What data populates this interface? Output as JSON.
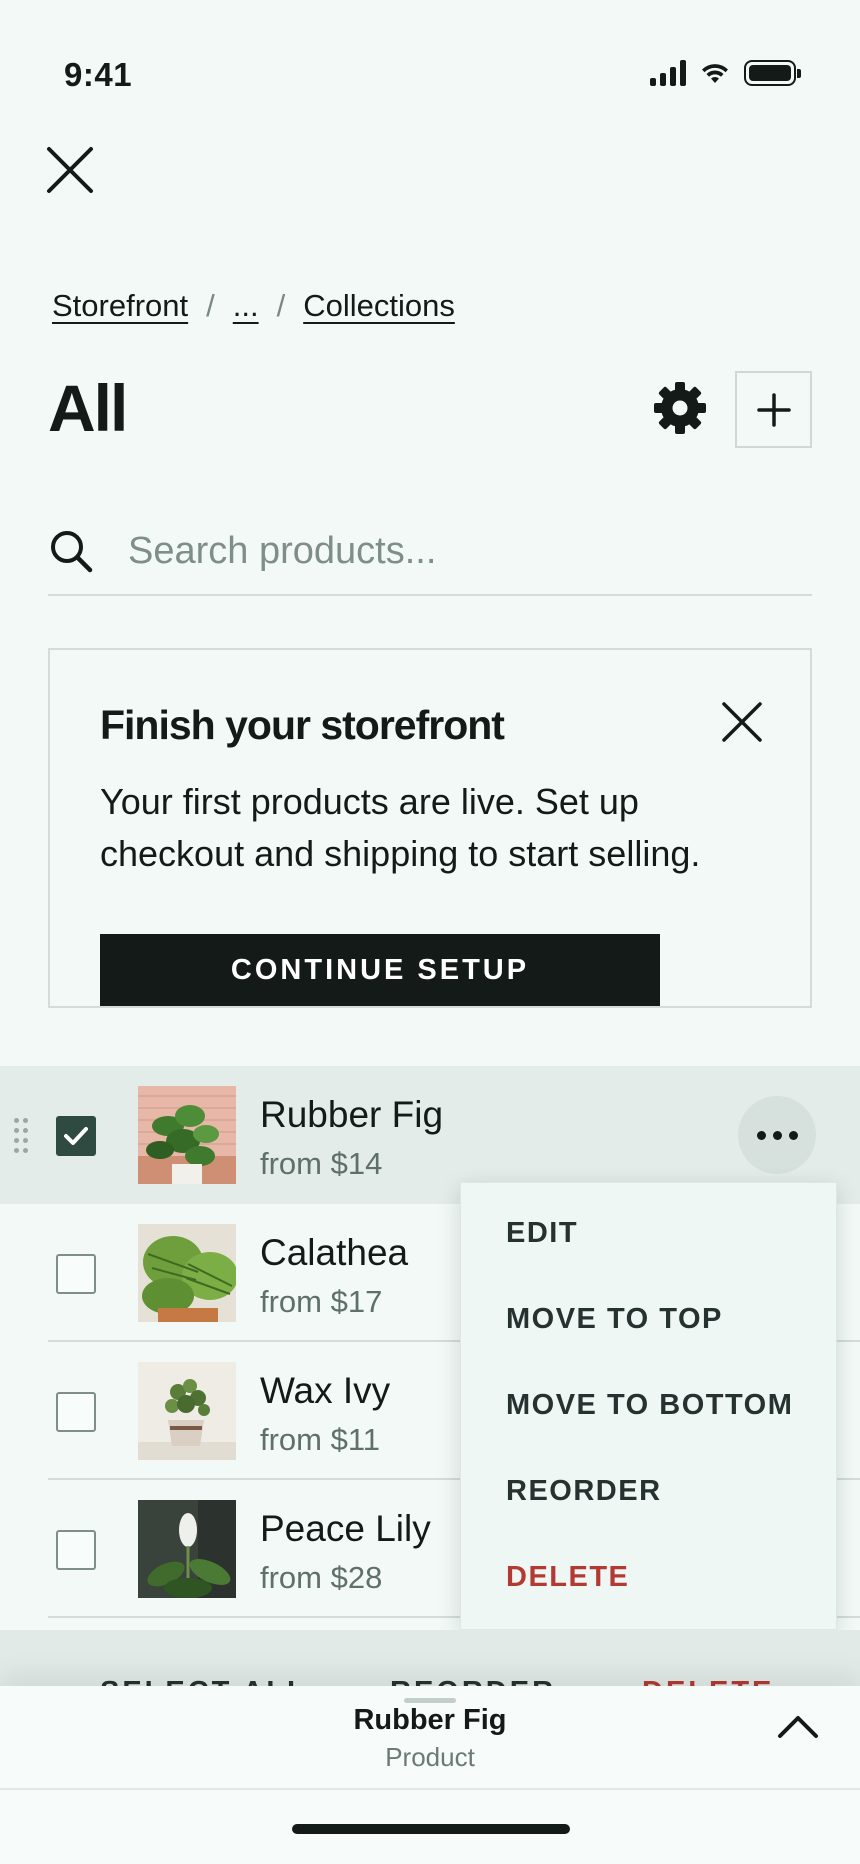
{
  "status_bar": {
    "time": "9:41"
  },
  "breadcrumb": {
    "items": [
      "Storefront",
      "...",
      "Collections"
    ],
    "separator": "/"
  },
  "page": {
    "title": "All"
  },
  "search": {
    "placeholder": "Search products..."
  },
  "banner": {
    "title": "Finish your storefront",
    "text": "Your first products are live. Set up checkout and shipping to start selling.",
    "cta": "CONTINUE SETUP"
  },
  "products": [
    {
      "name": "Rubber Fig",
      "price": "from $14",
      "checked": true
    },
    {
      "name": "Calathea",
      "price": "from $17",
      "checked": false
    },
    {
      "name": "Wax Ivy",
      "price": "from $11",
      "checked": false
    },
    {
      "name": "Peace Lily",
      "price": "from $28",
      "checked": false
    }
  ],
  "context_menu": {
    "items": [
      "EDIT",
      "MOVE TO TOP",
      "MOVE TO BOTTOM",
      "REORDER",
      "DELETE"
    ]
  },
  "action_bar": {
    "select_all": "SELECT ALL",
    "reorder": "REORDER",
    "delete": "DELETE"
  },
  "bottom_sheet": {
    "title": "Rubber Fig",
    "subtitle": "Product"
  },
  "colors": {
    "background": "#f3f9f7",
    "primary": "#141a18",
    "checkbox_checked": "#2f4a40",
    "danger": "#b33a32"
  }
}
